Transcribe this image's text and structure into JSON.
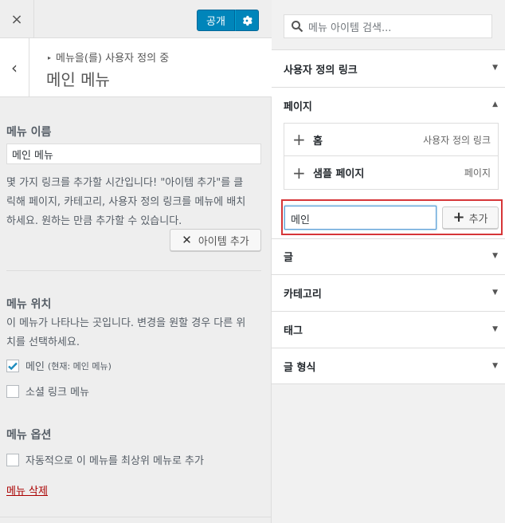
{
  "topbar": {
    "close_icon": "×",
    "publish_label": "공개",
    "settings_icon": "gear-icon"
  },
  "header": {
    "breadcrumb": "메뉴을(를) 사용자 정의 중",
    "title": "메인 메뉴",
    "back_icon": "‹"
  },
  "menu_name": {
    "label": "메뉴 이름",
    "value": "메인 메뉴"
  },
  "description": {
    "line1": "몇 가지 링크를 추가할 시간입니다! \"아이템 추가\"를 클",
    "line2": "릭해 페이지, 카테고리, 사용자 정의 링크를 메뉴에 배치",
    "line3": "하세요. 원하는 만큼 추가할 수 있습니다."
  },
  "add_items_button": "아이템 추가",
  "menu_locations": {
    "label": "메뉴 위치",
    "help_line1": "이 메뉴가 나타나는 곳입니다. 변경을 원할 경우 다른 위",
    "help_line2": "치를 선택하세요.",
    "options": [
      {
        "label": "메인",
        "note": "(현재: 메인 메뉴)",
        "checked": true
      },
      {
        "label": "소셜 링크 메뉴",
        "note": "",
        "checked": false
      }
    ]
  },
  "menu_options": {
    "label": "메뉴 옵션",
    "auto_add_label": "자동적으로 이 메뉴를 최상위 메뉴로 추가",
    "auto_add_checked": false
  },
  "delete_link": "메뉴 삭제",
  "right": {
    "search_placeholder": "메뉴 아이템 검색...",
    "sections": [
      {
        "title": "사용자 정의 링크",
        "expanded": false
      },
      {
        "title": "페이지",
        "expanded": true
      },
      {
        "title": "글",
        "expanded": false
      },
      {
        "title": "카테고리",
        "expanded": false
      },
      {
        "title": "태그",
        "expanded": false
      },
      {
        "title": "글 형식",
        "expanded": false
      }
    ],
    "pages": [
      {
        "title": "홈",
        "type": "사용자 정의 링크"
      },
      {
        "title": "샘플 페이지",
        "type": "페이지"
      }
    ],
    "page_search_value": "메인",
    "add_button": "추가"
  },
  "colors": {
    "primary": "#0085ba",
    "highlight": "#d63638",
    "delete": "#aa0000"
  }
}
